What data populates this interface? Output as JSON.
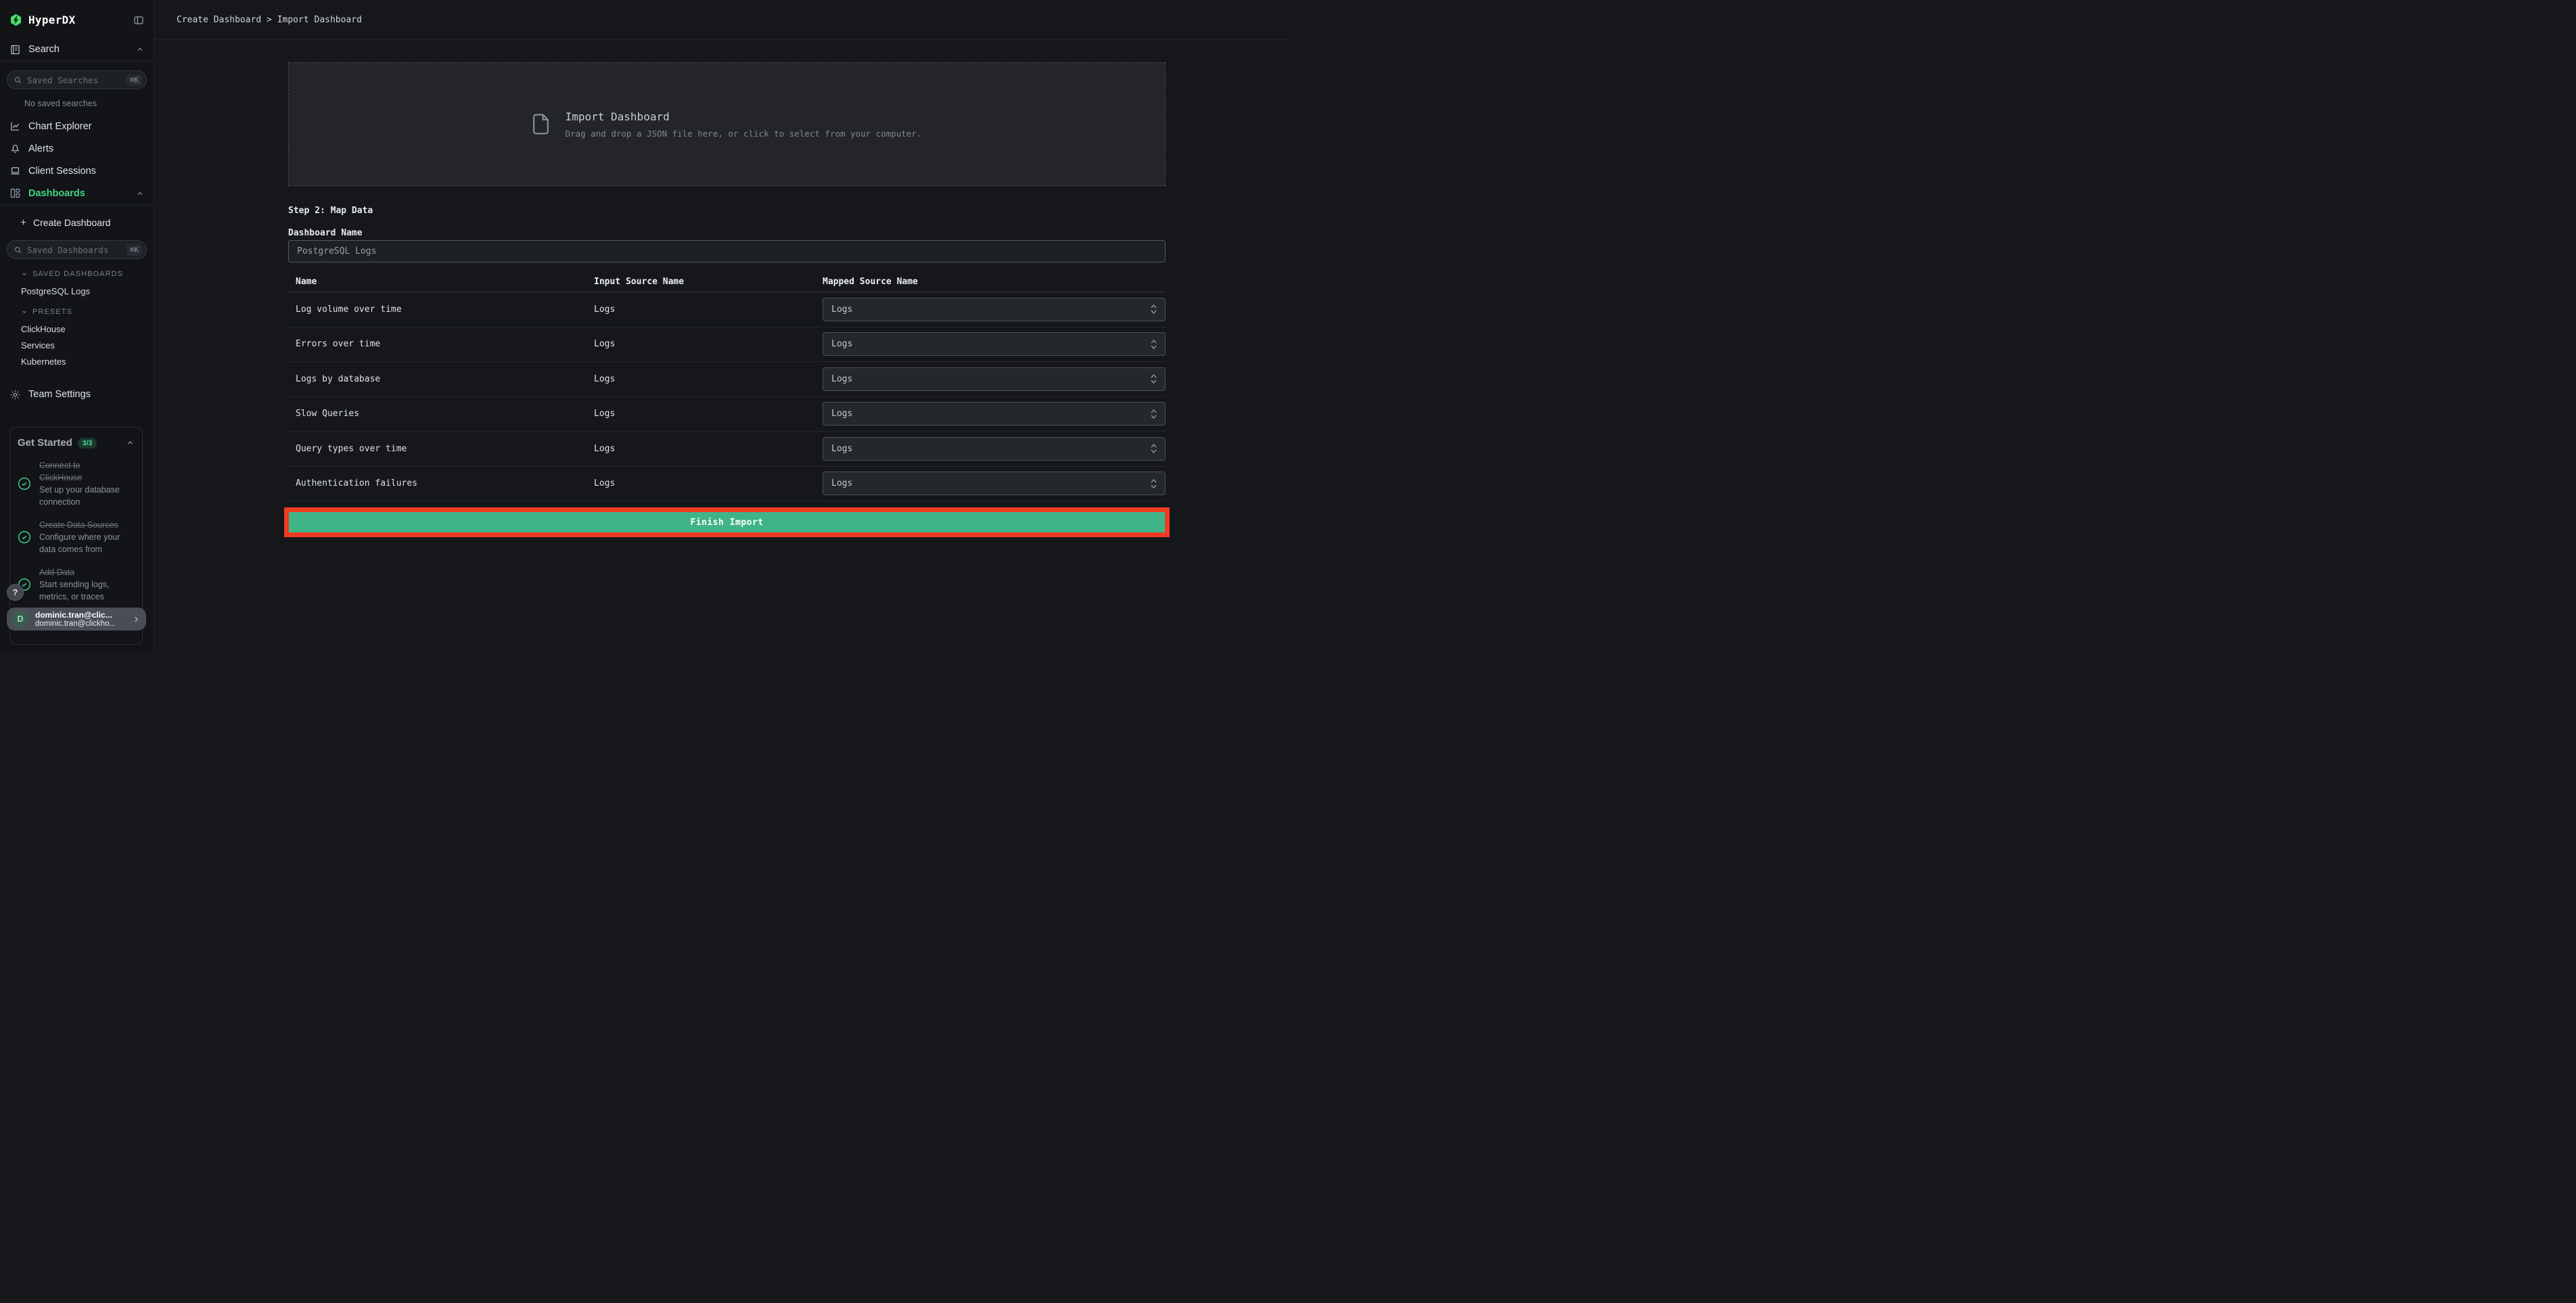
{
  "app": {
    "name": "HyperDX"
  },
  "header": {
    "breadcrumb": "Create Dashboard > Import Dashboard"
  },
  "sidebar": {
    "search": {
      "label": "Search",
      "placeholder": "Saved Searches",
      "shortcut": "⌘K",
      "empty": "No saved searches"
    },
    "nav": [
      {
        "label": "Chart Explorer"
      },
      {
        "label": "Alerts"
      },
      {
        "label": "Client Sessions"
      },
      {
        "label": "Dashboards"
      }
    ],
    "create_dashboard_label": "Create Dashboard",
    "dashboards_search": {
      "placeholder": "Saved Dashboards",
      "shortcut": "⌘K"
    },
    "saved_dashboards": {
      "header": "SAVED DASHBOARDS",
      "items": [
        "PostgreSQL Logs"
      ]
    },
    "presets": {
      "header": "PRESETS",
      "items": [
        "ClickHouse",
        "Services",
        "Kubernetes"
      ]
    },
    "team_settings_label": "Team Settings",
    "get_started": {
      "title": "Get Started",
      "badge": "3/3",
      "items": [
        {
          "title": "Connect to ClickHouse",
          "desc": "Set up your database connection"
        },
        {
          "title": "Create Data Sources",
          "desc": "Configure where your data comes from"
        },
        {
          "title": "Add Data",
          "desc": "Start sending logs, metrics, or traces"
        }
      ]
    },
    "help_label": "?",
    "user": {
      "initial": "D",
      "name": "dominic.tran@clic...",
      "email": "dominic.tran@clickho..."
    }
  },
  "main": {
    "dropzone": {
      "title": "Import Dashboard",
      "subtitle": "Drag and drop a JSON file here, or click to select from your computer."
    },
    "step_label": "Step 2: Map Data",
    "name_field": {
      "label": "Dashboard Name",
      "value": "PostgreSQL Logs"
    },
    "table": {
      "headers": [
        "Name",
        "Input Source Name",
        "Mapped Source Name"
      ],
      "rows": [
        {
          "name": "Log volume over time",
          "input_source": "Logs",
          "mapped_source": "Logs"
        },
        {
          "name": "Errors over time",
          "input_source": "Logs",
          "mapped_source": "Logs"
        },
        {
          "name": "Logs by database",
          "input_source": "Logs",
          "mapped_source": "Logs"
        },
        {
          "name": "Slow Queries",
          "input_source": "Logs",
          "mapped_source": "Logs"
        },
        {
          "name": "Query types over time",
          "input_source": "Logs",
          "mapped_source": "Logs"
        },
        {
          "name": "Authentication failures",
          "input_source": "Logs",
          "mapped_source": "Logs"
        }
      ]
    },
    "finish_label": "Finish Import"
  },
  "colors": {
    "brand_green": "#4bda66",
    "active_nav_green": "#43d483",
    "button_green": "#3fb487",
    "annotation_red": "#ef3b22",
    "check_green": "#3ee294"
  }
}
